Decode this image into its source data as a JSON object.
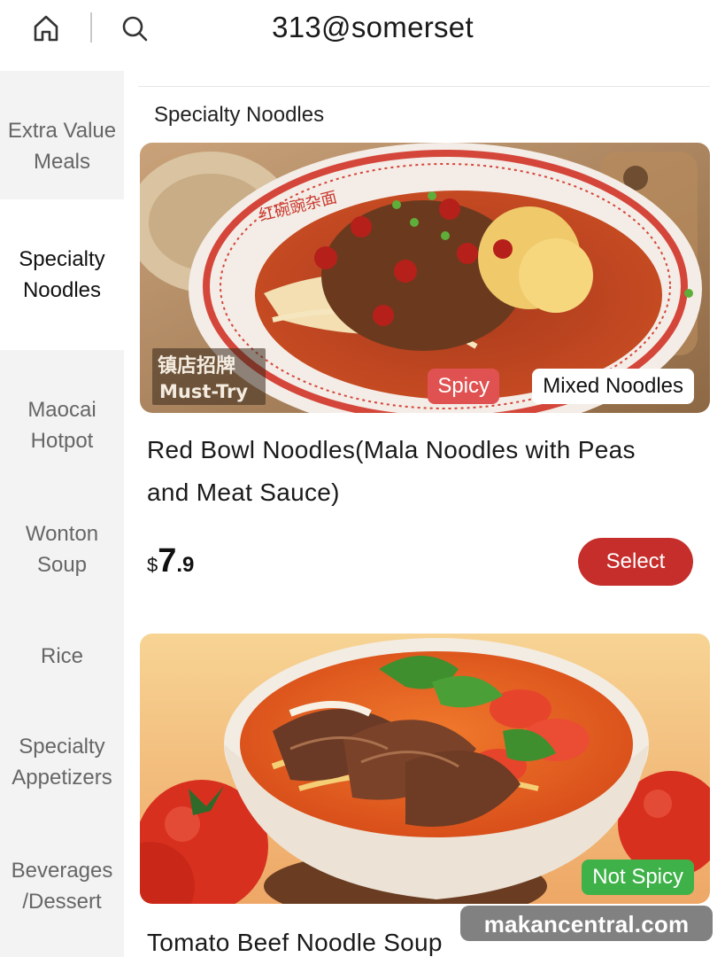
{
  "header": {
    "title": "313@somerset",
    "home_icon": "home-icon",
    "search_icon": "search-icon"
  },
  "sidebar": {
    "items": [
      {
        "label": "Extra Value Meals",
        "active": false
      },
      {
        "label": "Specialty Noodles",
        "active": true
      },
      {
        "label": "Maocai Hotpot",
        "active": false
      },
      {
        "label": "Wonton Soup",
        "active": false
      },
      {
        "label": "Rice",
        "active": false
      },
      {
        "label": "Specialty Appetizers",
        "active": false
      },
      {
        "label": "Beverages /Dessert",
        "active": false
      }
    ]
  },
  "main": {
    "section_title": "Specialty Noodles",
    "items": [
      {
        "name": "Red Bowl Noodles(Mala Noodles with Peas and Meat Sauce)",
        "tags": [
          "Spicy",
          "Mixed Noodles"
        ],
        "image_text": {
          "bowl_text": "红碗豌杂面",
          "stamp_top": "镇店招牌",
          "stamp_bottom": "Must-Try"
        },
        "price": {
          "currency": "$",
          "integer": "7",
          "decimal": ".9"
        },
        "select_label": "Select"
      },
      {
        "name": "Tomato Beef Noodle Soup",
        "tags": [
          "Not Spicy"
        ]
      }
    ]
  },
  "watermark": "makancentral.com",
  "colors": {
    "accent_red": "#c62e2b",
    "spicy_tag": "#e05252",
    "not_spicy_tag": "#3eb249",
    "sidebar_bg": "#f3f3f3"
  }
}
